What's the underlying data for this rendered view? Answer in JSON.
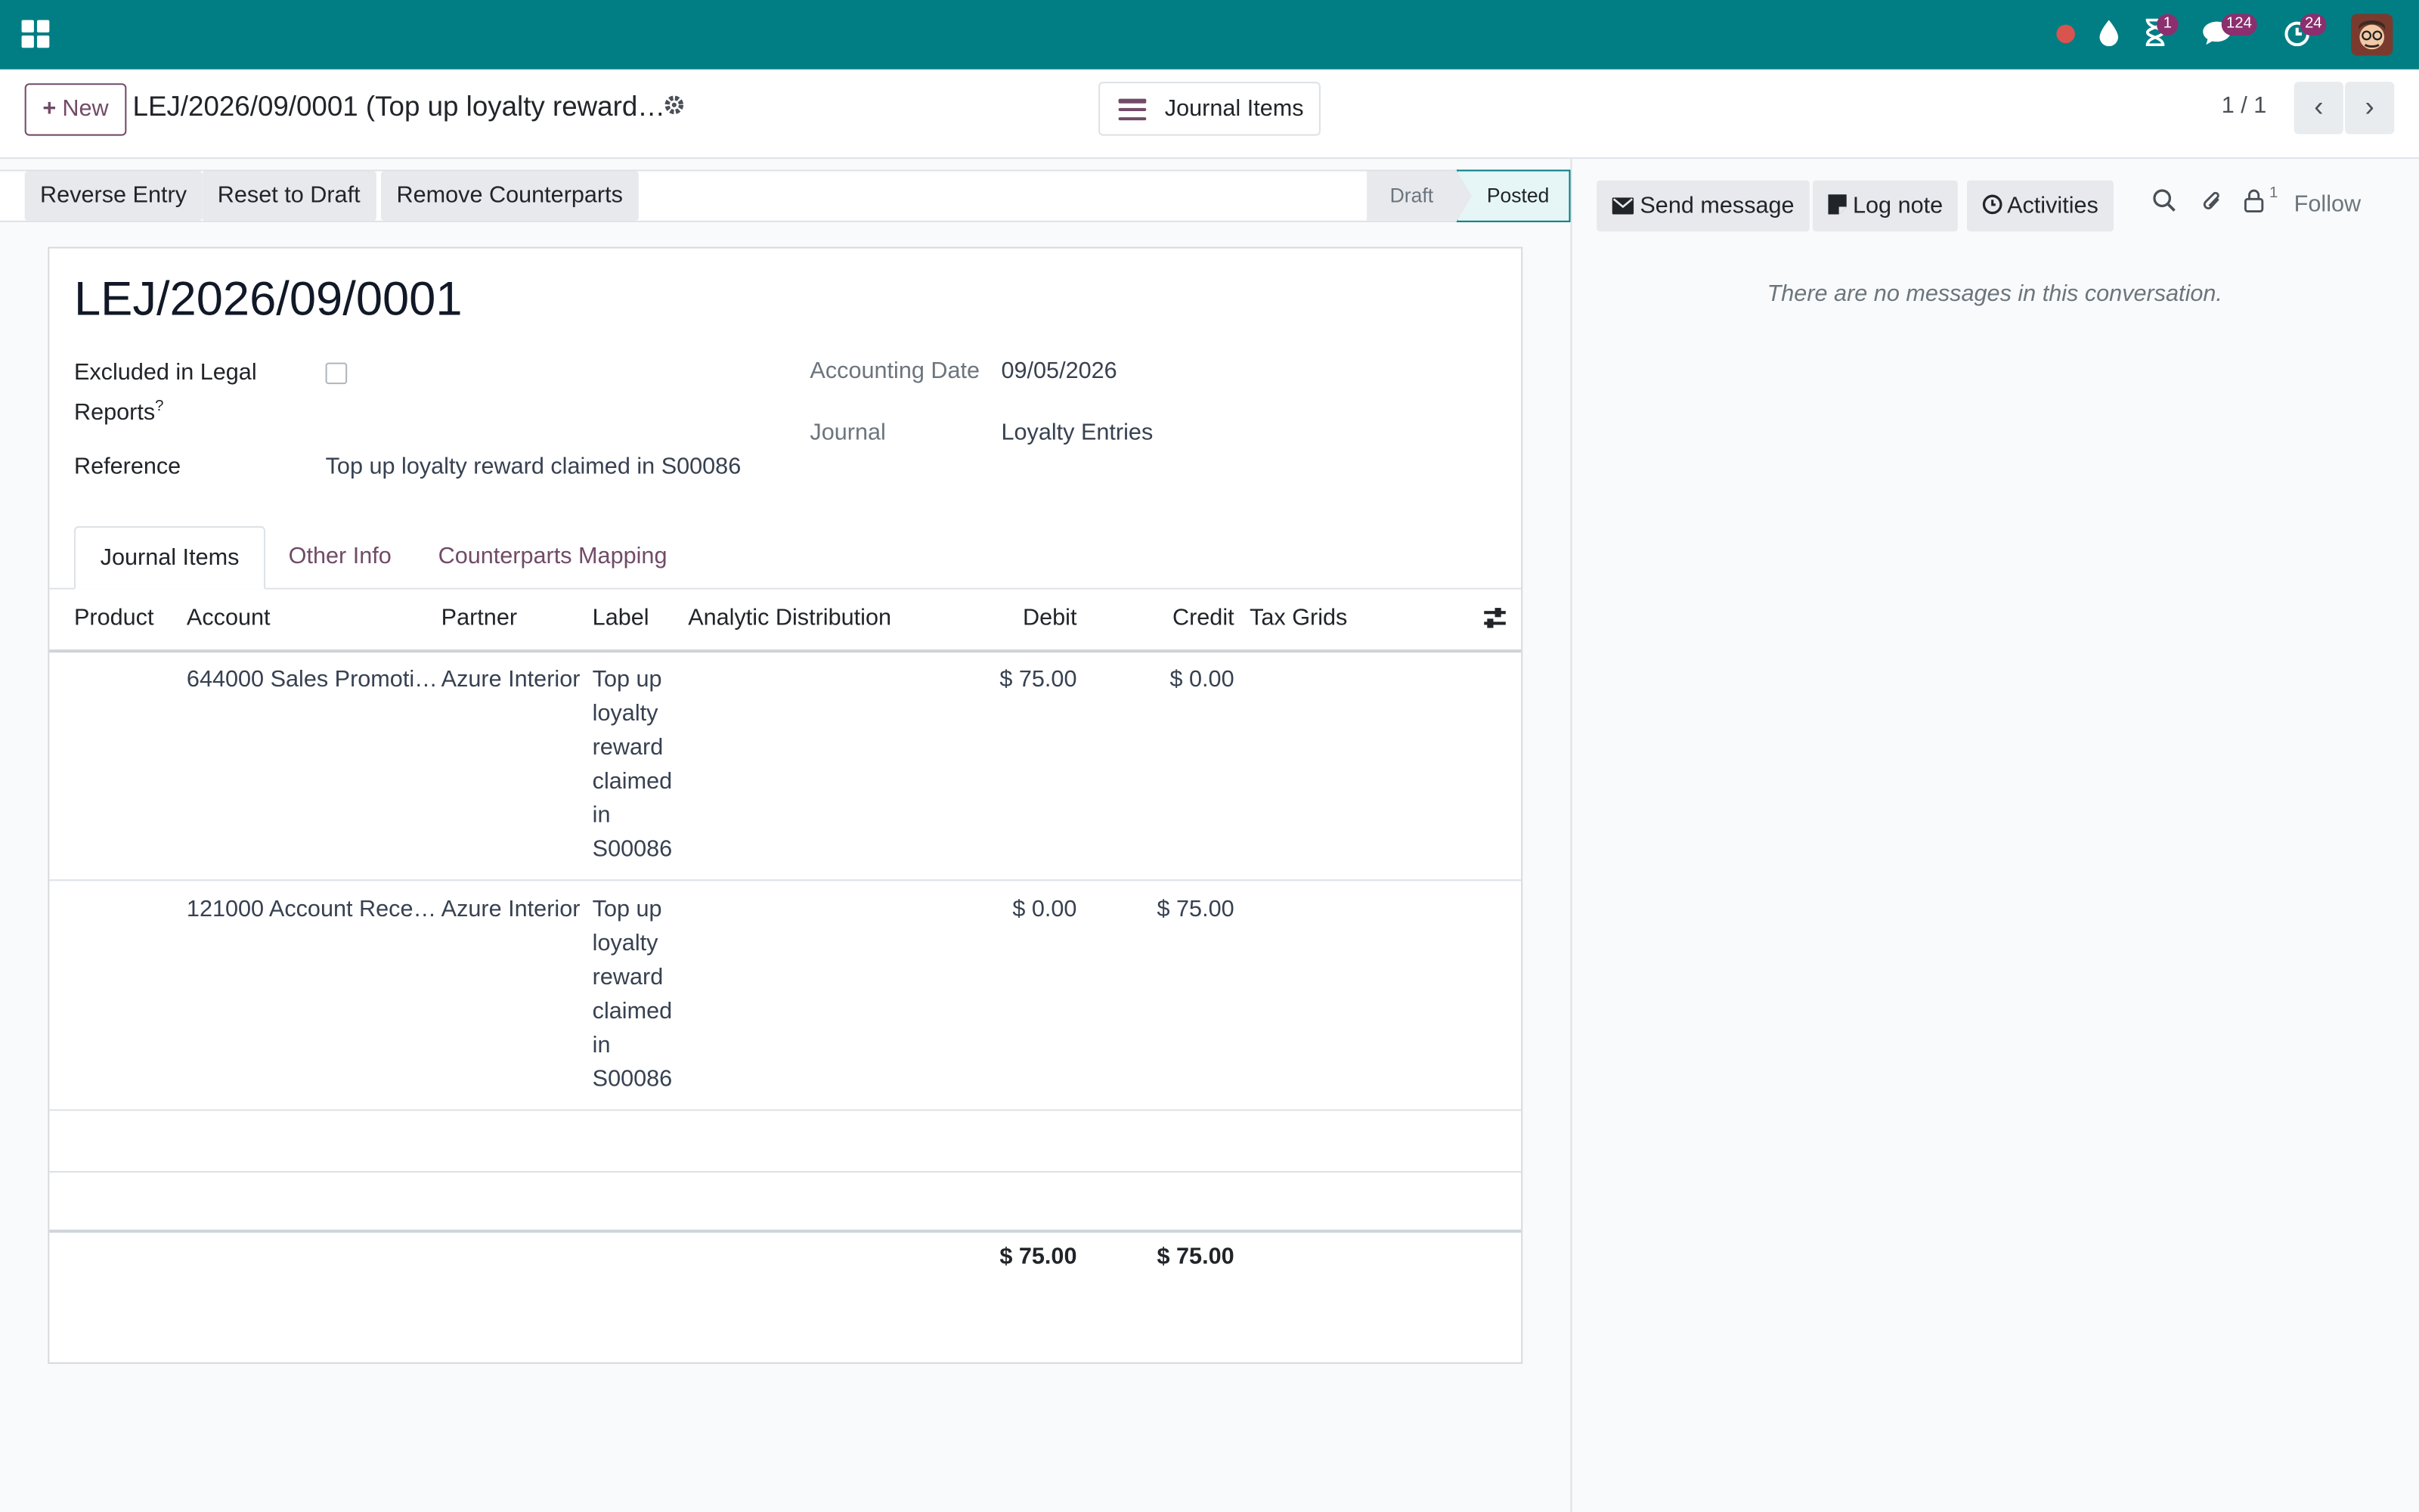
{
  "navbar": {
    "apps_icon": "grid-icon",
    "systray": {
      "recorder_icon": "red-dot-icon",
      "drop_icon": "drop-icon",
      "activity_badge": "1",
      "messages_badge": "124",
      "timer_badge": "24"
    },
    "accent_color": "#017e84"
  },
  "control_panel": {
    "new_label": "New",
    "breadcrumb": "LEJ/2026/09/0001 (Top up loyalty reward…",
    "smart_button_label": "Journal Items",
    "pager_value": "1 / 1"
  },
  "statusbar": {
    "actions": [
      "Reverse Entry",
      "Reset to Draft",
      "Remove Counterparts"
    ],
    "stages": [
      "Draft",
      "Posted"
    ],
    "current_stage": "Posted"
  },
  "form": {
    "title": "LEJ/2026/09/0001",
    "excluded_label_line1": "Excluded in Legal",
    "excluded_label_line2": "Reports",
    "excluded_help": "?",
    "reference_label": "Reference",
    "reference_value": "Top up loyalty reward claimed in S00086",
    "accounting_date_label": "Accounting Date",
    "accounting_date_value": "09/05/2026",
    "journal_label": "Journal",
    "journal_value": "Loyalty Entries"
  },
  "tabs": [
    "Journal Items",
    "Other Info",
    "Counterparts Mapping"
  ],
  "table": {
    "columns": [
      "Product",
      "Account",
      "Partner",
      "Label",
      "Analytic Distribution",
      "Debit",
      "Credit",
      "Tax Grids"
    ],
    "rows": [
      {
        "product": "",
        "account": "644000 Sales Promoti…",
        "partner": "Azure Interior",
        "label": "Top up loyalty reward claimed in S00086",
        "analytic": "",
        "debit": "$ 75.00",
        "credit": "$ 0.00",
        "tax_grids": ""
      },
      {
        "product": "",
        "account": "121000 Account Rece…",
        "partner": "Azure Interior",
        "label": "Top up loyalty reward claimed in S00086",
        "analytic": "",
        "debit": "$ 0.00",
        "credit": "$ 75.00",
        "tax_grids": ""
      }
    ],
    "total_debit": "$ 75.00",
    "total_credit": "$ 75.00"
  },
  "chatter": {
    "send_message": "Send message",
    "log_note": "Log note",
    "activities": "Activities",
    "followers_count": "1",
    "follow": "Follow",
    "empty_text": "There are no messages in this conversation."
  }
}
